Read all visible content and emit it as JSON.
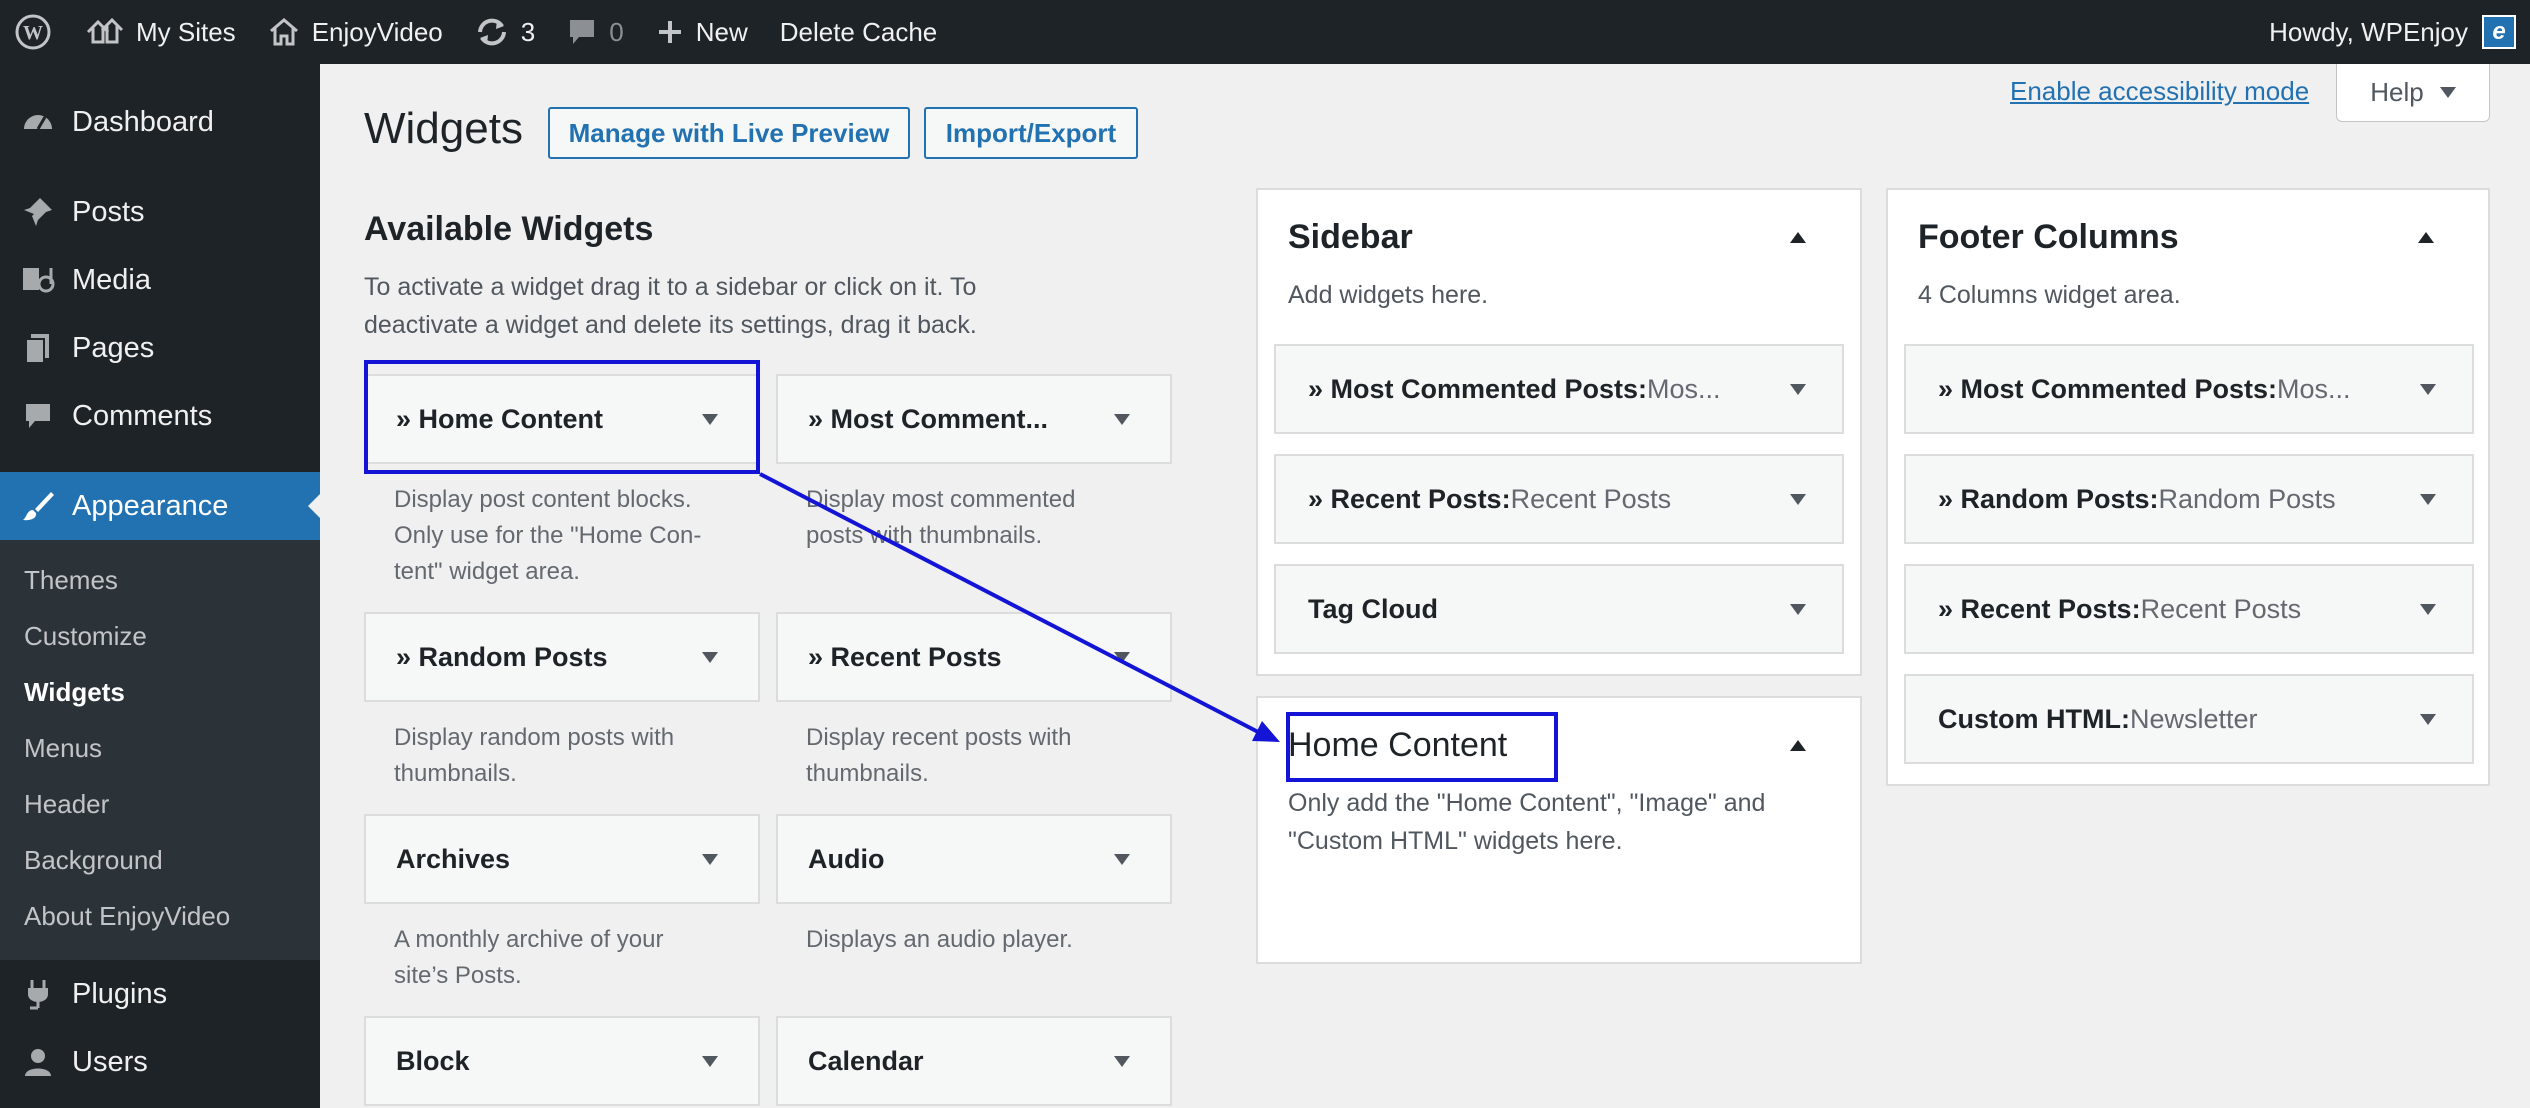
{
  "adminbar": {
    "my_sites": "My Sites",
    "site_name": "EnjoyVideo",
    "updates_count": "3",
    "comments_count": "0",
    "new_label": "New",
    "delete_cache": "Delete Cache",
    "howdy": "Howdy, WPEnjoy",
    "avatar_letter": "e"
  },
  "sidebar": {
    "dashboard": "Dashboard",
    "posts": "Posts",
    "media": "Media",
    "pages": "Pages",
    "comments": "Comments",
    "appearance": "Appearance",
    "submenu": [
      "Themes",
      "Customize",
      "Widgets",
      "Menus",
      "Header",
      "Background",
      "About EnjoyVideo"
    ],
    "plugins": "Plugins",
    "users": "Users"
  },
  "screen_meta": {
    "accessibility_link": "Enable accessibility mode",
    "help": "Help"
  },
  "header": {
    "title": "Widgets",
    "live_preview_btn": "Manage with Live Preview",
    "import_export_btn": "Import/Export"
  },
  "available": {
    "title": "Available Widgets",
    "description": "To activate a widget drag it to a sidebar or click on it. To deactivate a widget and delete its settings, drag it back.",
    "widgets": [
      {
        "title": "» Home Content",
        "desc_lines": [
          "Display post content blocks.",
          "Only use for the \"Home Con-",
          "tent\" widget area."
        ]
      },
      {
        "title": "» Most Comment...",
        "desc_lines": [
          "Display most commented",
          "posts with thumbnails."
        ]
      },
      {
        "title": "» Random Posts",
        "desc_lines": [
          "Display random posts with",
          "thumbnails."
        ]
      },
      {
        "title": "» Recent Posts",
        "desc_lines": [
          "Display recent posts with",
          "thumbnails."
        ]
      },
      {
        "title": "Archives",
        "desc_lines": [
          "A monthly archive of your",
          "site’s Posts."
        ]
      },
      {
        "title": "Audio",
        "desc_lines": [
          "Displays an audio player."
        ]
      },
      {
        "title": "Block",
        "desc_lines": []
      },
      {
        "title": "Calendar",
        "desc_lines": []
      }
    ]
  },
  "areas": {
    "sidebar": {
      "title": "Sidebar",
      "description": "Add widgets here.",
      "widgets": [
        {
          "title": "» Most Commented Posts:",
          "sub": " Mos..."
        },
        {
          "title": "» Recent Posts:",
          "sub": " Recent Posts"
        },
        {
          "title": "Tag Cloud",
          "sub": ""
        }
      ]
    },
    "home_content": {
      "title": "Home Content",
      "description_lines": [
        "Only add the \"Home Content\", \"Image\" and",
        "\"Custom HTML\" widgets here."
      ]
    },
    "footer": {
      "title": "Footer Columns",
      "description": "4 Columns widget area.",
      "widgets": [
        {
          "title": "» Most Commented Posts:",
          "sub": " Mos..."
        },
        {
          "title": "» Random Posts:",
          "sub": " Random Posts"
        },
        {
          "title": "» Recent Posts:",
          "sub": " Recent Posts"
        },
        {
          "title": "Custom HTML:",
          "sub": " Newsletter"
        }
      ]
    }
  },
  "colors": {
    "accent": "#2271b1",
    "adminbar_bg": "#1d2327",
    "annotation": "#1414d6"
  }
}
